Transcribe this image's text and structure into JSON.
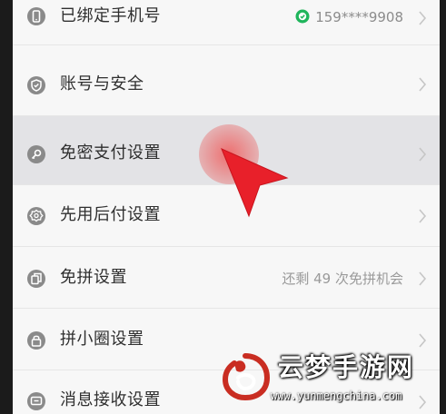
{
  "settings": {
    "items": [
      {
        "icon": "phone-icon",
        "label": "已绑定手机号",
        "value": "159****9908",
        "value_icon": "verified-check-icon"
      },
      {
        "icon": "shield-icon",
        "label": "账号与安全",
        "value": ""
      },
      {
        "icon": "key-icon",
        "label": "免密支付设置",
        "value": ""
      },
      {
        "icon": "badge-icon",
        "label": "先用后付设置",
        "value": ""
      },
      {
        "icon": "copy-icon",
        "label": "免拼设置",
        "value": "还剩 49 次免拼机会"
      },
      {
        "icon": "lock-icon",
        "label": "拼小圈设置",
        "value": ""
      },
      {
        "icon": "message-icon",
        "label": "消息接收设置",
        "value": ""
      }
    ],
    "highlighted_item": "免密支付设置"
  },
  "overlay": {
    "pointer": "red-arrow-icon",
    "tap_indicator": "tap-dot"
  },
  "watermark": {
    "title": "云梦手游网",
    "url": "www.yunmengchina.com"
  },
  "colors": {
    "verified_green": "#1fb55b",
    "pointer_red": "#e8202a",
    "icon_gray": "#8a8a8a",
    "text": "#2f2f2f",
    "secondary_text": "#9a9a9a",
    "highlight_row": "#e3e3e6"
  }
}
